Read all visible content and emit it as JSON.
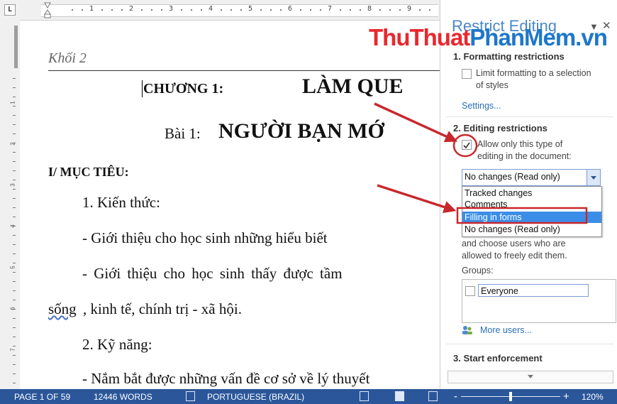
{
  "ruler": {
    "corner_label": "L",
    "numbers": [
      "1",
      "2",
      "3",
      "4",
      "5",
      "6",
      "7",
      "8",
      "9"
    ],
    "left_numbers": [
      "1",
      "2",
      "3",
      "4",
      "5",
      "6",
      "7"
    ]
  },
  "document": {
    "heading_italic": "Khối 2",
    "chapter_label": "CHƯƠNG 1:",
    "chapter_title": "LÀM QUE",
    "lesson_label": "Bài 1:",
    "lesson_title": "NGƯỜI BẠN MỚ",
    "section1": "I/ MỤC TIÊU:",
    "item1": "1. Kiến thức:",
    "line1": "- Giới thiệu cho học sinh những hiểu biết",
    "line2": "- Giới thiệu cho học sinh thấy được tầm",
    "line3_word": "sống",
    "line3_rest": ", kinh tế, chính trị - xã hội.",
    "item2": "2. Kỹ năng:",
    "line4": "- Nắm bắt được những vấn đề cơ sở về lý thuyết"
  },
  "pane": {
    "title": "Restrict Editing",
    "menu_icon": "chevron-down-icon",
    "close_icon": "close-icon",
    "sec1": "1. Formatting restrictions",
    "limit_label_1": "Limit formatting to a selection",
    "limit_label_2": "of styles",
    "settings_link": "Settings...",
    "sec2": "2. Editing restrictions",
    "allow_label_1": "Allow only this type of",
    "allow_label_2": "editing in the document:",
    "dropdown_value": "No changes (Read only)",
    "options": [
      "Tracked changes",
      "Comments",
      "Filling in forms",
      "No changes (Read only)"
    ],
    "selected_option": "Filling in forms",
    "choose_text_1": "and choose users who are",
    "choose_text_2": "allowed to freely edit them.",
    "groups_label": "Groups:",
    "everyone": "Everyone",
    "more_users": "More users...",
    "sec3": "3. Start enforcement"
  },
  "status": {
    "page": "PAGE 1 OF 59",
    "words": "12446 WORDS",
    "language": "PORTUGUESE (BRAZIL)",
    "zoom_minus": "-",
    "zoom_plus": "+",
    "zoom": "120%",
    "zoom_level": 1.2
  },
  "watermark": {
    "part1": "ThuThuat",
    "part2": "PhanMem",
    "part3": ".vn",
    "color1": "#e8282f",
    "color2": "#1e77c9"
  },
  "colors": {
    "statusbar": "#2b579a",
    "accent": "#2a6fb5",
    "selection": "#3b8ee8",
    "annotation": "#c8282c"
  }
}
